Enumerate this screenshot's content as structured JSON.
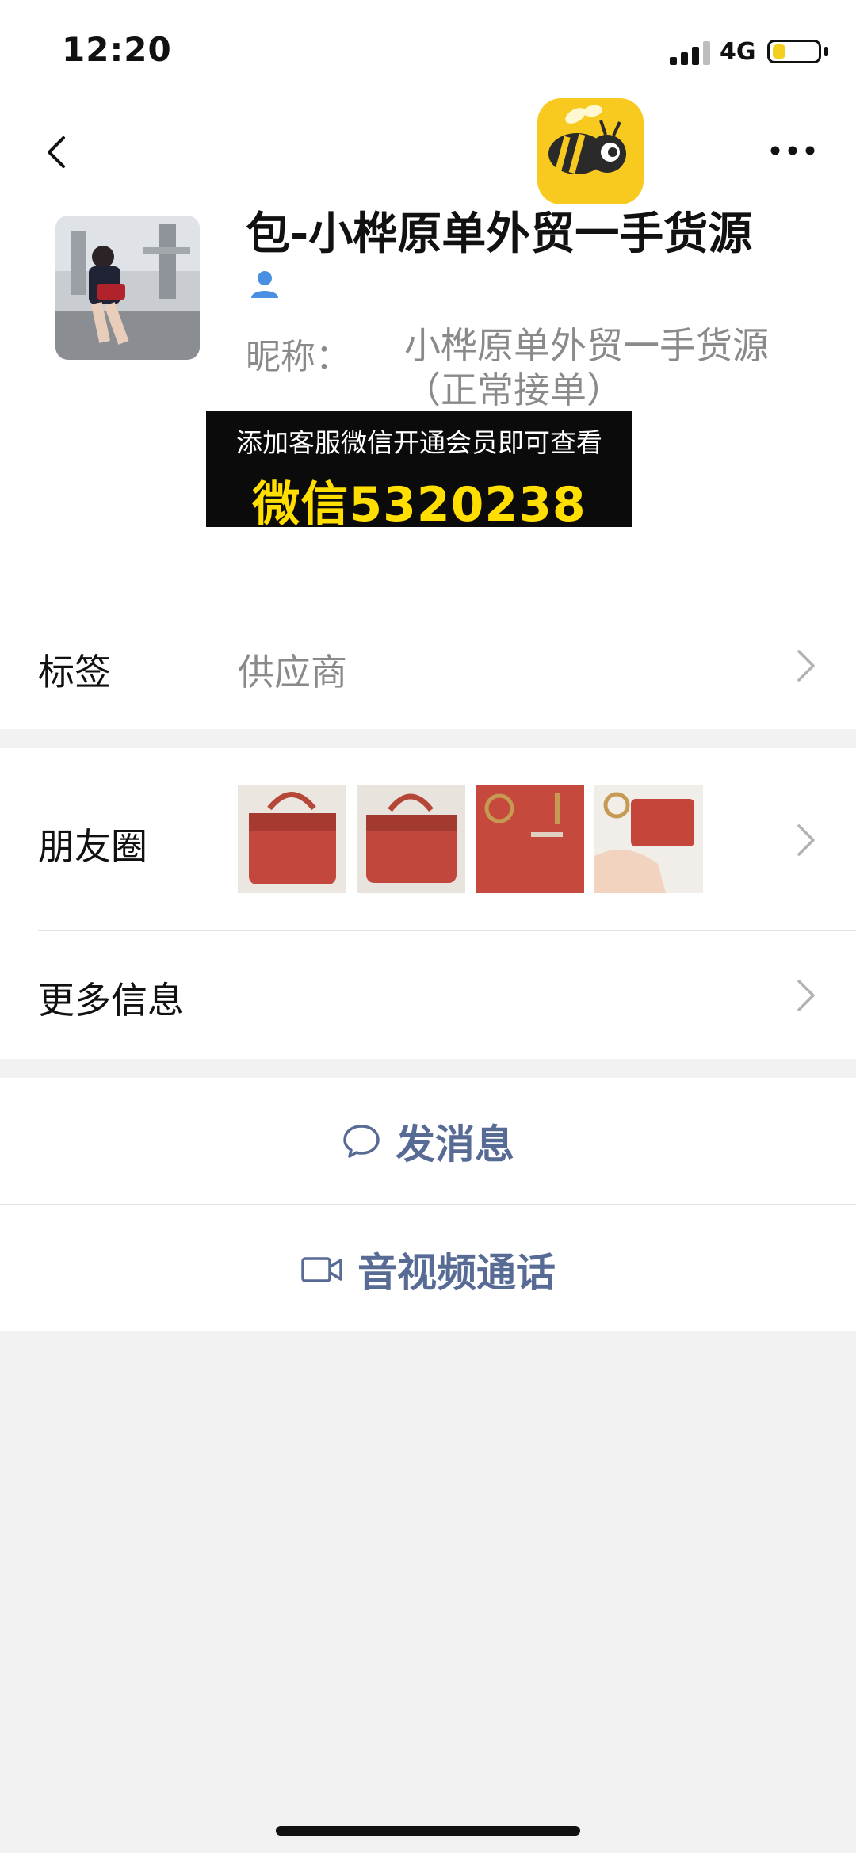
{
  "status_bar": {
    "time": "12:20",
    "network": "4G",
    "battery_level": 0.3
  },
  "header": {
    "name": "包-小桦原单外贸一手货源",
    "nickname_label": "昵称：",
    "nickname_value": "小桦原单外贸一手货源（正常接单）"
  },
  "ad_banner": {
    "line1": "添加客服微信开通会员即可查看",
    "line2": "微信5320238"
  },
  "rows": {
    "tag_label": "标签",
    "tag_value": "供应商",
    "moments_label": "朋友圈",
    "more_info_label": "更多信息"
  },
  "actions": {
    "message": "发消息",
    "video_call": "音视频通话"
  },
  "colors": {
    "link_blue": "#576b95",
    "ad_yellow": "#ffde00",
    "battery_yellow": "#f4cf1e",
    "logo_yellow": "#f8c91e"
  },
  "icons": [
    "back-arrow-icon",
    "more-dots-icon",
    "bee-app-logo-icon",
    "person-icon",
    "chevron-right-icon",
    "chat-bubble-icon",
    "video-camera-icon"
  ]
}
